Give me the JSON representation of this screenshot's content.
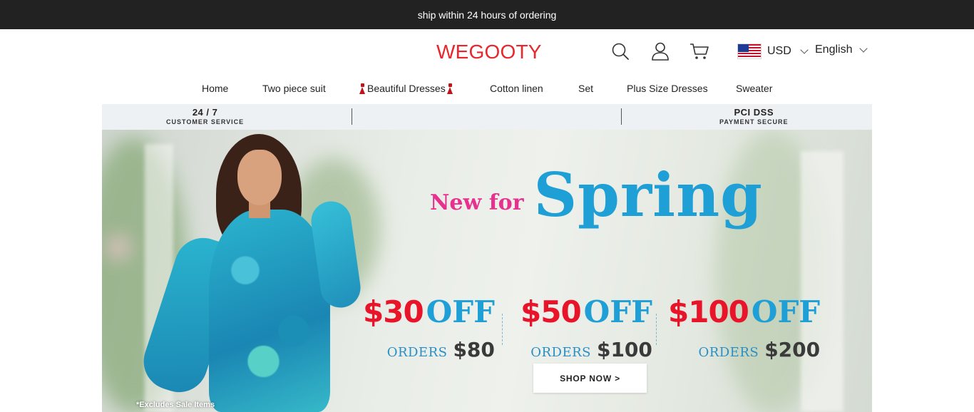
{
  "announcement": {
    "text": "ship within 24 hours of ordering"
  },
  "header": {
    "logo": "WEGOOTY",
    "icons": [
      "search-icon",
      "account-icon",
      "cart-icon"
    ],
    "currency": {
      "flag": "us-flag-icon",
      "label": "USD"
    },
    "language": {
      "label": "English"
    }
  },
  "nav": {
    "items": [
      {
        "label": "Home"
      },
      {
        "label": "Two piece suit"
      },
      {
        "label": "Beautiful Dresses",
        "decoration": "red-dress-icon"
      },
      {
        "label": "Cotton linen"
      },
      {
        "label": "Set"
      },
      {
        "label": "Plus Size Dresses"
      },
      {
        "label": "Sweater"
      }
    ]
  },
  "trust_bar": {
    "left": {
      "big": "24 / 7",
      "small": "CUSTOMER SERVICE"
    },
    "right": {
      "big": "PCI DSS",
      "small": "PAYMENT SECURE"
    }
  },
  "hero": {
    "headline_small": "New for",
    "headline_big": "Spring",
    "offers": [
      {
        "amount": "$30",
        "off": "OFF",
        "orders_label": "ORDERS",
        "minimum": "$80"
      },
      {
        "amount": "$50",
        "off": "OFF",
        "orders_label": "ORDERS",
        "minimum": "$100"
      },
      {
        "amount": "$100",
        "off": "OFF",
        "orders_label": "ORDERS",
        "minimum": "$200"
      }
    ],
    "cta": "SHOP NOW >",
    "footnote": "*Excludes Sale Items",
    "colors": {
      "pink": "#e6318f",
      "blue": "#1e9fd6",
      "red": "#e8152a"
    }
  }
}
